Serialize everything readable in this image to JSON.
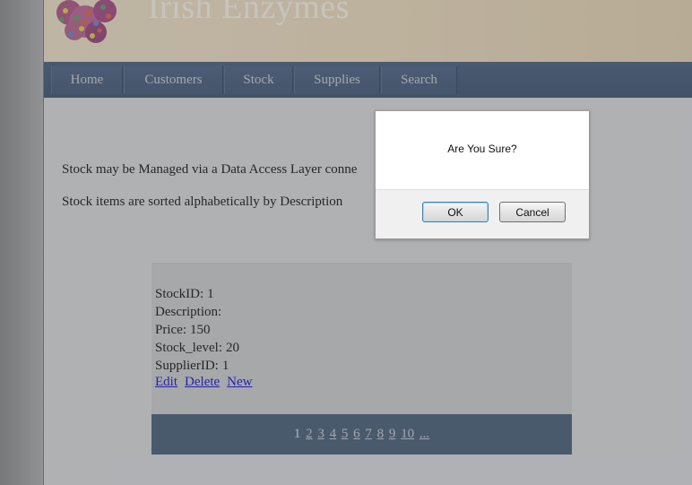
{
  "site": {
    "title": "Irish Enzymes"
  },
  "nav": {
    "items": [
      "Home",
      "Customers",
      "Stock",
      "Supplies",
      "Search"
    ]
  },
  "content": {
    "intro_line_1": "Stock may be Managed via a Data Access Layer conne",
    "intro_line_2": "Stock items are sorted alphabetically by Description"
  },
  "record": {
    "fields": [
      {
        "label": "StockID:",
        "value": "1"
      },
      {
        "label": "Description:",
        "value": ""
      },
      {
        "label": "Price:",
        "value": "150"
      },
      {
        "label": "Stock_level:",
        "value": "20"
      },
      {
        "label": "SupplierID:",
        "value": "1"
      }
    ],
    "actions": [
      "Edit",
      "Delete",
      "New"
    ]
  },
  "pager": {
    "current": "1",
    "pages": [
      "2",
      "3",
      "4",
      "5",
      "6",
      "7",
      "8",
      "9",
      "10",
      "..."
    ]
  },
  "dialog": {
    "message": "Are You Sure?",
    "ok_label": "OK",
    "cancel_label": "Cancel"
  },
  "colors": {
    "banner": "#efe0c2",
    "nav": "#4a607d",
    "pager": "#50667f",
    "link": "#1a1ad8"
  }
}
